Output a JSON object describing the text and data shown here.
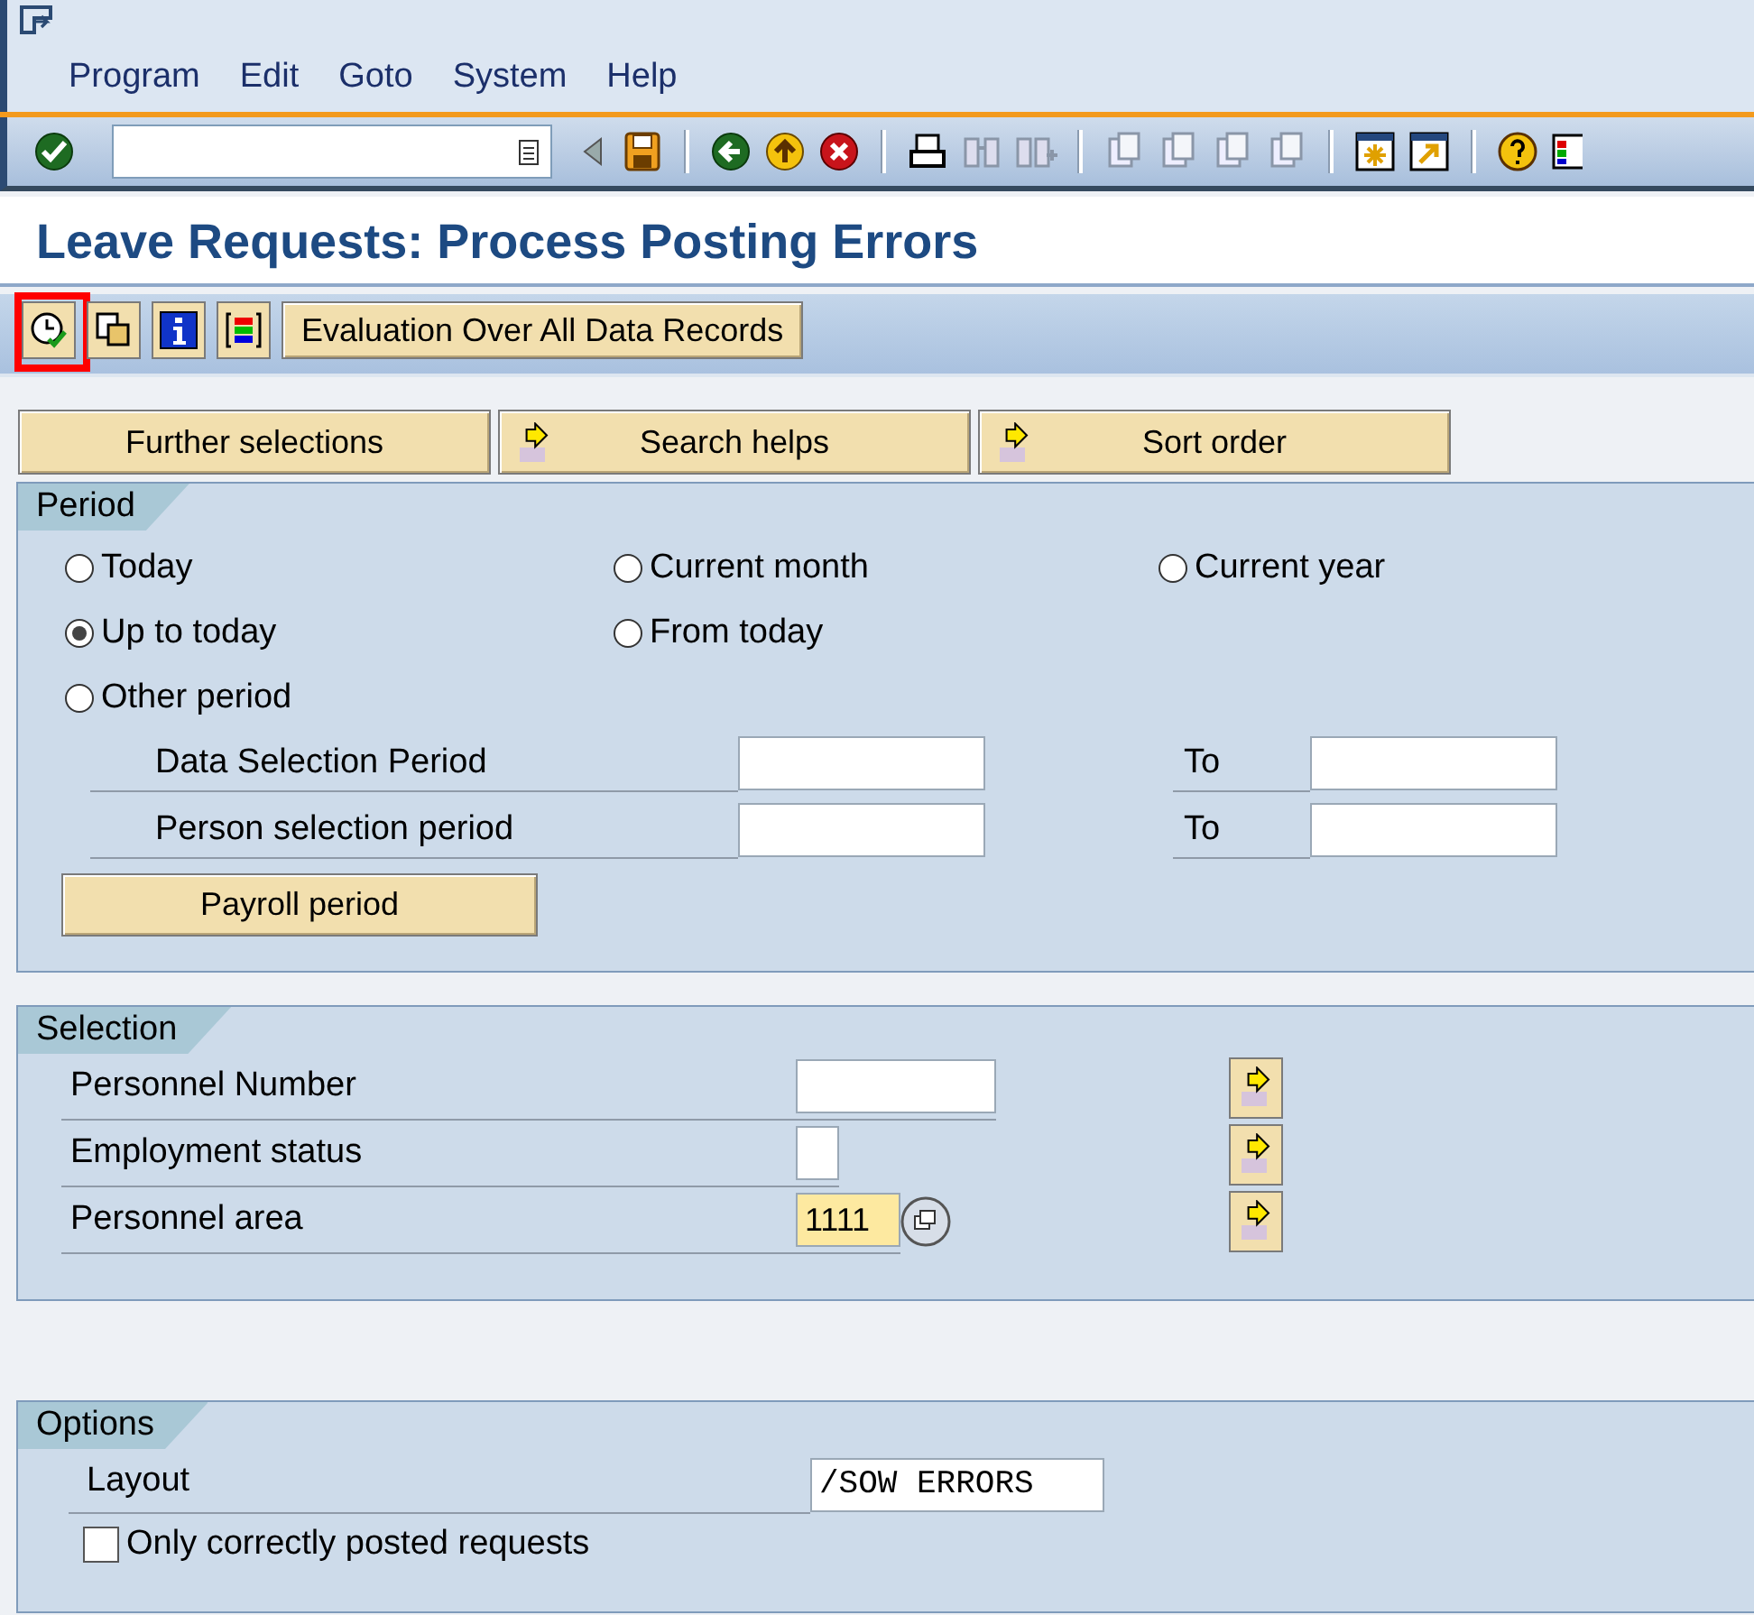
{
  "menu": [
    {
      "label": "Program"
    },
    {
      "label": "Edit"
    },
    {
      "label": "Goto"
    },
    {
      "label": "System"
    },
    {
      "label": "Help"
    }
  ],
  "title": "Leave Requests: Process Posting Errors",
  "app_toolbar": {
    "icons": [
      {
        "kind": "execute",
        "highlighted": true
      },
      {
        "kind": "variants",
        "highlighted": false
      },
      {
        "kind": "info",
        "highlighted": false
      },
      {
        "kind": "layout",
        "highlighted": false
      }
    ],
    "button": "Evaluation Over All Data Records"
  },
  "tab_buttons": [
    {
      "label": "Further selections",
      "arrow": false
    },
    {
      "label": "Search helps",
      "arrow": true
    },
    {
      "label": "Sort order",
      "arrow": true
    }
  ],
  "period": {
    "title": "Period",
    "radio_rows": [
      [
        {
          "label": "Today",
          "selected": false
        },
        {
          "label": "Current month",
          "selected": false
        },
        {
          "label": "Current year",
          "selected": false
        }
      ],
      [
        {
          "label": "Up to today",
          "selected": true
        },
        {
          "label": "From today",
          "selected": false
        }
      ],
      [
        {
          "label": "Other period",
          "selected": false
        }
      ]
    ],
    "ranges": [
      {
        "label": "Data Selection Period",
        "to_label": "To"
      },
      {
        "label": "Person selection period",
        "to_label": "To"
      }
    ],
    "button": "Payroll period"
  },
  "selection": {
    "title": "Selection",
    "rows": [
      {
        "label": "Personnel Number",
        "kind": "text"
      },
      {
        "label": "Employment status",
        "kind": "flag"
      },
      {
        "label": "Personnel area",
        "kind": "lookup",
        "value": "1111",
        "focused": true
      }
    ]
  },
  "options": {
    "title": "Options",
    "layout": {
      "label": "Layout",
      "value": "/SOW ERRORS"
    },
    "checkbox": {
      "label": "Only correctly posted requests",
      "checked": false
    }
  }
}
